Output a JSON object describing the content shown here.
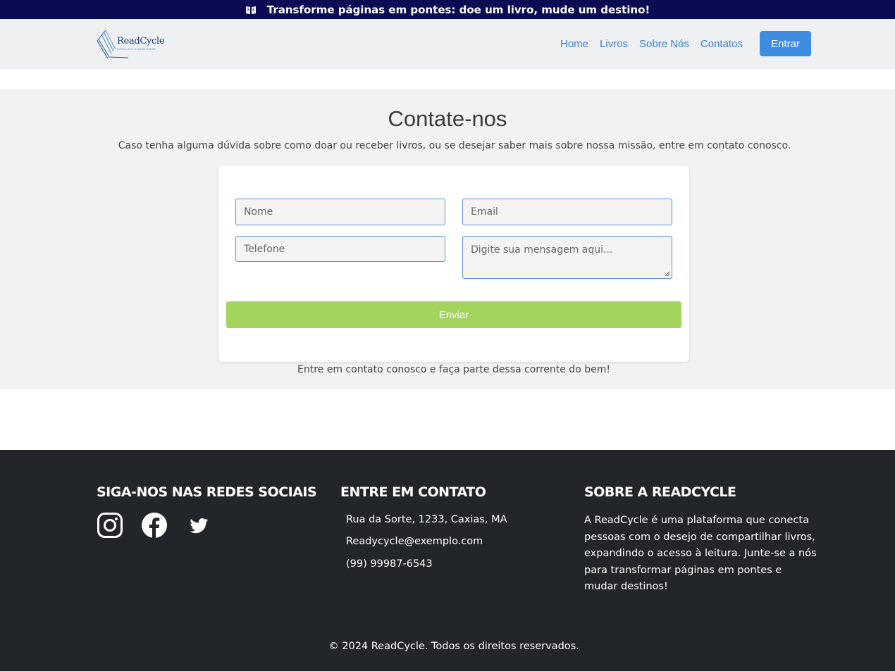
{
  "announcement": {
    "icon": "open-book-icon",
    "text": "Transforme páginas em pontes: doe um livro, mude um destino!"
  },
  "header": {
    "logo": {
      "name": "ReadCycle",
      "tagline": "CIRCLING KNOWLEDGE"
    },
    "nav": [
      {
        "label": "Home"
      },
      {
        "label": "Livros"
      },
      {
        "label": "Sobre Nós"
      },
      {
        "label": "Contatos"
      }
    ],
    "login_label": "Entrar"
  },
  "contact": {
    "title": "Contate-nos",
    "subtitle": "Caso tenha alguma dúvida sobre como doar ou receber livros, ou se desejar saber mais sobre nossa missão, entre em contato conosco.",
    "form": {
      "name_placeholder": "Nome",
      "email_placeholder": "Email",
      "phone_placeholder": "Telefone",
      "message_placeholder": "Digite sua mensagem aqui...",
      "submit_label": "Enviar"
    },
    "footnote": "Entre em contato conosco e faça parte dessa corrente do bem!"
  },
  "footer": {
    "social": {
      "title": "SIGA-NOS NAS REDES SOCIAIS",
      "icons": [
        "instagram-icon",
        "facebook-icon",
        "twitter-icon"
      ]
    },
    "contact": {
      "title": "ENTRE EM CONTATO",
      "address": "Rua da Sorte, 1233, Caxias, MA",
      "email": "Readycycle@exemplo.com",
      "phone": "(99) 99987-6543"
    },
    "about": {
      "title": "SOBRE A READCYCLE",
      "text": "A ReadCycle é uma plataforma que conecta pessoas com o desejo de compartilhar livros, expandindo o acesso à leitura. Junte-se a nós para transformar páginas em pontes e mudar destinos!"
    },
    "copyright": "© 2024 ReadCycle. Todos os direitos reservados."
  },
  "colors": {
    "announcement_bg": "#0b0b54",
    "nav_link": "#3d7fc9",
    "primary_button": "#3f8ce0",
    "submit_button": "#a3d55e",
    "footer_bg": "#22252a"
  }
}
